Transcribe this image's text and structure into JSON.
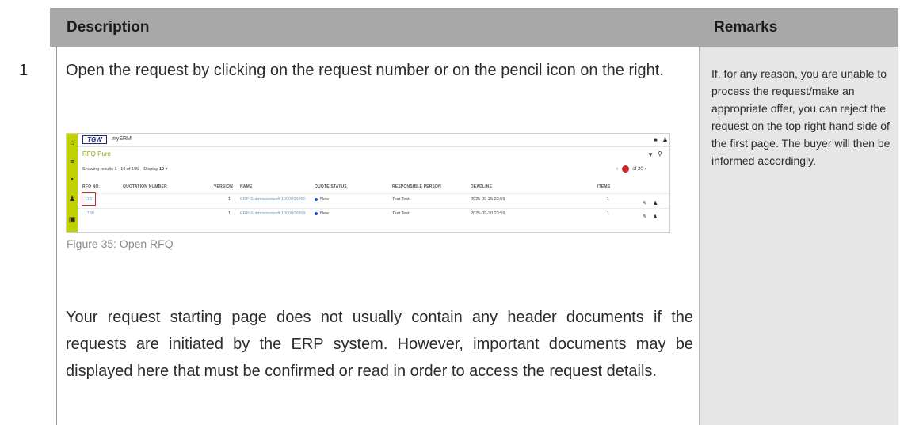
{
  "header": {
    "description": "Description",
    "remarks": "Remarks"
  },
  "row": {
    "number": "1",
    "paragraph1": "Open the request by clicking on the request number or on the pencil icon on the right.",
    "caption": "Figure 35: Open RFQ",
    "paragraph2": "Your request starting page does not usually contain any header documents if the requests are initiated by the ERP system. However, important documents may be displayed here that must be confirmed or read in order to access the request details.",
    "remarks": "If, for any reason, you are unable to process the request/make an appropriate offer, you can reject the request on the top right-hand side of the first page. The buyer will then be informed accordingly."
  },
  "screenshot": {
    "logo": "TGW",
    "app_name": "mySRM",
    "page_title": "RFQ Pure",
    "showing": "Showing results 1 - 10 of 195",
    "display_label": "Display",
    "display_value": "10",
    "pager_of": "of",
    "pager_total": "20",
    "columns": [
      "RFQ NO.",
      "QUOTATION NUMBER",
      "VERSION",
      "NAME",
      "QUOTE STATUS",
      "RESPONSIBLE PERSON",
      "DEADLINE",
      "ITEMS"
    ],
    "rows": [
      {
        "rfq": "1131",
        "quotation": "",
        "version": "1",
        "name": "ERP-Submissionsoft 1000006860",
        "status": "New",
        "person": "Test Testi",
        "deadline": "2025-09-25 23:59",
        "items": "1"
      },
      {
        "rfq": "1130",
        "quotation": "",
        "version": "1",
        "name": "ERP-Submissionsoft 1000006859",
        "status": "New",
        "person": "Test Testi",
        "deadline": "2025-09-20 23:59",
        "items": "1"
      }
    ],
    "icons": {
      "sidebar": [
        "home-icon",
        "list-icon",
        "documents-icon",
        "user-add-icon",
        "car-icon"
      ],
      "topbar": [
        "chat-icon",
        "user-icon"
      ],
      "tools": [
        "filter-icon",
        "search-icon"
      ],
      "row_actions": [
        "pencil-icon",
        "person-icon"
      ]
    },
    "accent_color": "#c1d100",
    "highlight_color": "#d62828"
  }
}
